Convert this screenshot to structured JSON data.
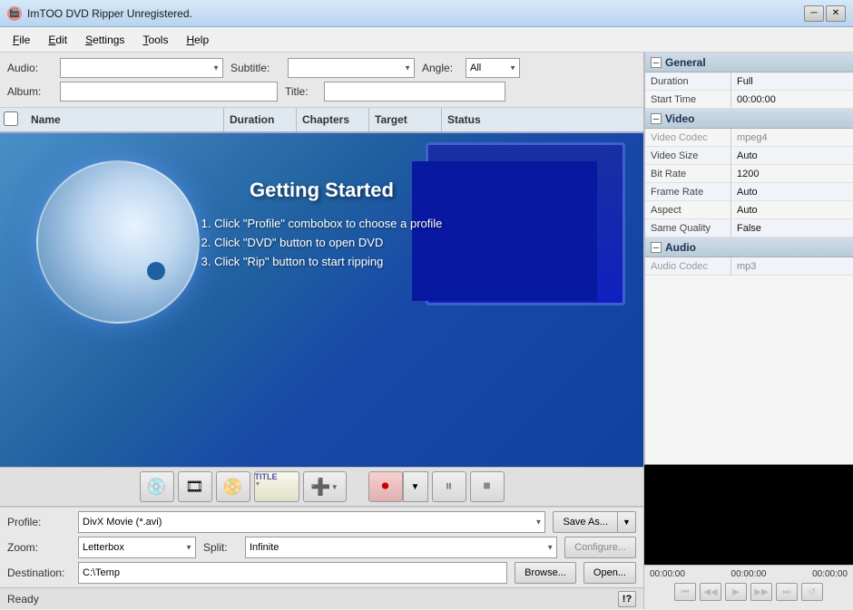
{
  "app": {
    "title": "ImTOO DVD Ripper Unregistered.",
    "icon": "🎬"
  },
  "window_controls": {
    "minimize": "─",
    "close": "✕"
  },
  "menu": {
    "items": [
      {
        "label": "File",
        "underline": "F",
        "id": "file"
      },
      {
        "label": "Edit",
        "underline": "E",
        "id": "edit"
      },
      {
        "label": "Settings",
        "underline": "S",
        "id": "settings"
      },
      {
        "label": "Tools",
        "underline": "T",
        "id": "tools"
      },
      {
        "label": "Help",
        "underline": "H",
        "id": "help"
      }
    ]
  },
  "controls": {
    "audio_label": "Audio:",
    "subtitle_label": "Subtitle:",
    "angle_label": "Angle:",
    "angle_value": "All",
    "album_label": "Album:",
    "title_label": "Title:"
  },
  "table": {
    "headers": [
      "Name",
      "Duration",
      "Chapters",
      "Target",
      "Status"
    ]
  },
  "content": {
    "title": "Getting Started",
    "instructions": [
      "1. Click \"Profile\" combobox to choose a profile",
      "2. Click \"DVD\" button to open DVD",
      "3. Click \"Rip\" button to start ripping"
    ]
  },
  "toolbar": {
    "dvd_icon": "💿",
    "film_icon": "🎞",
    "disc_icon": "📀",
    "title_label": "TITLE",
    "add_icon": "➕",
    "record_icon": "⏺",
    "pause_icon": "⏸",
    "stop_icon": "⏹"
  },
  "bottom": {
    "profile_label": "Profile:",
    "profile_value": "DivX Movie (*.avi)",
    "save_as_label": "Save As...",
    "zoom_label": "Zoom:",
    "zoom_value": "Letterbox",
    "split_label": "Split:",
    "split_value": "Infinite",
    "configure_label": "Configure...",
    "destination_label": "Destination:",
    "destination_value": "C:\\Temp",
    "browse_label": "Browse...",
    "open_label": "Open..."
  },
  "status": {
    "text": "Ready",
    "help": "!?"
  },
  "properties": {
    "general_section": "General",
    "general_items": [
      {
        "key": "Duration",
        "value": "Full"
      },
      {
        "key": "Start Time",
        "value": "00:00:00"
      }
    ],
    "video_section": "Video",
    "video_items": [
      {
        "key": "Video Codec",
        "value": "mpeg4",
        "disabled": true
      },
      {
        "key": "Video Size",
        "value": "Auto"
      },
      {
        "key": "Bit Rate",
        "value": "1200"
      },
      {
        "key": "Frame Rate",
        "value": "Auto"
      },
      {
        "key": "Aspect",
        "value": "Auto"
      },
      {
        "key": "Same Quality",
        "value": "False"
      }
    ],
    "audio_section": "Audio",
    "audio_items": [
      {
        "key": "Audio Codec",
        "value": "mp3"
      }
    ]
  },
  "preview": {
    "time1": "00:00:00",
    "time2": "00:00:00",
    "time3": "00:00:00",
    "btn_prev": "⏮",
    "btn_back": "◀◀",
    "btn_play": "▶",
    "btn_fwd": "▶▶",
    "btn_end": "⏭",
    "btn_loop": "↺"
  }
}
